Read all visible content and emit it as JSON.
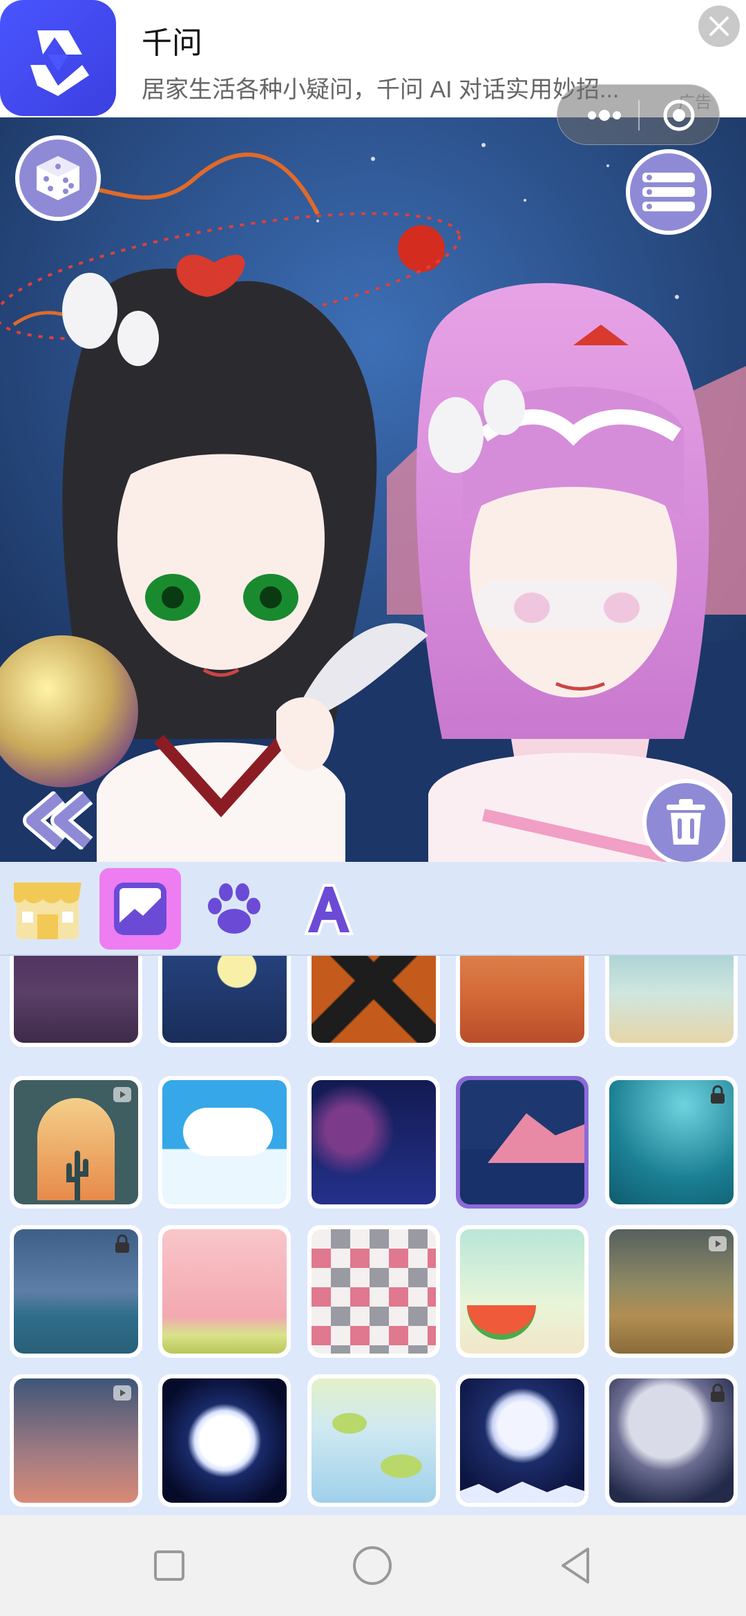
{
  "ad": {
    "title": "千问",
    "description": "居家生活各种小疑问，千问 AI 对话实用妙招...",
    "tag": "广告",
    "icons": {
      "logo": "qianwen-logo-icon",
      "close": "close-icon"
    }
  },
  "capsule": {
    "more": "more-dots-icon",
    "target": "target-icon"
  },
  "canvas": {
    "buttons": {
      "random": "dice-icon",
      "menu": "list-icon",
      "back": "double-chevron-left-icon",
      "delete": "trash-icon"
    }
  },
  "toolbar": {
    "tabs": [
      {
        "name": "shop",
        "icon": "shop-icon",
        "active": false
      },
      {
        "name": "background",
        "icon": "image-icon",
        "active": true
      },
      {
        "name": "pet",
        "icon": "paw-icon",
        "active": false
      },
      {
        "name": "text",
        "icon": "letter-a-icon",
        "active": false
      }
    ]
  },
  "backgrounds": [
    {
      "theme": "neon-city",
      "locked": false,
      "video": false
    },
    {
      "theme": "moon-city",
      "locked": false,
      "video": false
    },
    {
      "theme": "dark-cross",
      "locked": false,
      "video": false
    },
    {
      "theme": "desert-sunset-birds",
      "locked": false,
      "video": false
    },
    {
      "theme": "dreamy-tree",
      "locked": true,
      "video": false
    },
    {
      "theme": "cactus-window",
      "locked": false,
      "video": true
    },
    {
      "theme": "clouds-sky",
      "locked": false,
      "video": false
    },
    {
      "theme": "night-bridge",
      "locked": false,
      "video": false
    },
    {
      "theme": "sea-mountain",
      "locked": false,
      "video": false,
      "selected": true
    },
    {
      "theme": "underwater",
      "locked": true,
      "video": false
    },
    {
      "theme": "cloudy-sea",
      "locked": true,
      "video": false
    },
    {
      "theme": "sakura",
      "locked": false,
      "video": false
    },
    {
      "theme": "argyle",
      "locked": false,
      "video": false
    },
    {
      "theme": "watermelon",
      "locked": false,
      "video": false
    },
    {
      "theme": "desert-dunes",
      "locked": false,
      "video": true
    },
    {
      "theme": "dusk-gradient",
      "locked": false,
      "video": true
    },
    {
      "theme": "full-moon",
      "locked": false,
      "video": false
    },
    {
      "theme": "lily-pond",
      "locked": false,
      "video": false
    },
    {
      "theme": "moon-ice",
      "locked": false,
      "video": false
    },
    {
      "theme": "moon-stars",
      "locked": true,
      "video": false
    }
  ],
  "navbar": {
    "recent": "square-icon",
    "home": "circle-icon",
    "back": "triangle-back-icon"
  },
  "colors": {
    "accent": "#ee7df2",
    "selected": "#8c6ad8",
    "button": "#8f8ad6"
  }
}
